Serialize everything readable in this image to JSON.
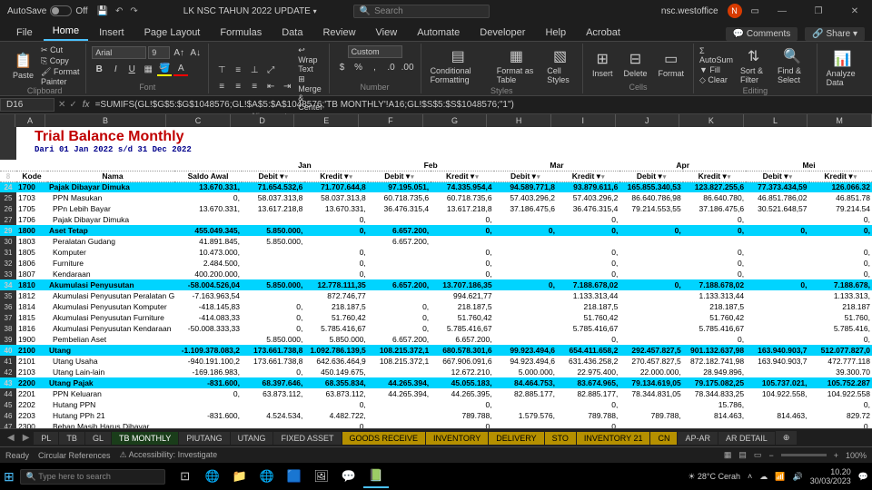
{
  "titlebar": {
    "autosave": "AutoSave",
    "off": "Off",
    "docname": "LK NSC TAHUN 2022 UPDATE",
    "search": "Search",
    "user": "nsc.westoffice",
    "initial": "N"
  },
  "tabs": {
    "items": [
      "File",
      "Home",
      "Insert",
      "Page Layout",
      "Formulas",
      "Data",
      "Review",
      "View",
      "Automate",
      "Developer",
      "Help",
      "Acrobat"
    ],
    "active": 1,
    "comments": "Comments",
    "share": "Share"
  },
  "ribbon": {
    "clipboard": {
      "paste": "Paste",
      "cut": "Cut",
      "copy": "Copy",
      "fp": "Format Painter",
      "label": "Clipboard"
    },
    "font": {
      "name": "Arial",
      "size": "9",
      "label": "Font"
    },
    "alignment": {
      "wrap": "Wrap Text",
      "merge": "Merge & Center",
      "label": "Alignment"
    },
    "number": {
      "fmt": "Custom",
      "label": "Number"
    },
    "styles": {
      "cf": "Conditional Formatting",
      "fat": "Format as Table",
      "cs": "Cell Styles",
      "label": "Styles"
    },
    "cells": {
      "insert": "Insert",
      "delete": "Delete",
      "format": "Format",
      "label": "Cells"
    },
    "editing": {
      "autosum": "AutoSum",
      "fill": "Fill",
      "clear": "Clear",
      "sort": "Sort & Filter",
      "find": "Find & Select",
      "label": "Editing"
    },
    "analysis": {
      "ad": "Analyze Data"
    }
  },
  "namebox": {
    "cell": "D16",
    "formula": "=SUMIFS(GL!$G$5:$G$1048576;GL!$A$5:$A$1048576;'TB MONTHLY'!A16;GL!$S$5:$S$1048576;\"1\")"
  },
  "sheet": {
    "title": "Trial Balance Monthly",
    "subtitle": "Dari 01 Jan 2022 s/d 31 Dec 2022",
    "cols": [
      "A",
      "B",
      "C",
      "D",
      "E",
      "F",
      "G",
      "H",
      "I",
      "J",
      "K",
      "L",
      "M"
    ],
    "months": [
      "Jan",
      "Feb",
      "Mar",
      "Apr",
      "Mei"
    ],
    "dk": [
      "Debit",
      "Kredit"
    ],
    "headers": [
      "Kode",
      "Nama",
      "Saldo Awal"
    ],
    "rows": [
      {
        "r": 24,
        "cat": true,
        "k": "1700",
        "n": "Pajak Dibayar Dimuka",
        "s": "13.670.331,",
        "d": [
          "71.654.532,6",
          "71.707.644,8",
          "97.195.051,",
          "74.335.954,4",
          "94.589.771,8",
          "93.879.611,6",
          "165.855.340,53",
          "123.827.255,6",
          "77.373.434,59",
          "126.066.32"
        ]
      },
      {
        "r": 25,
        "k": "1703",
        "n": "PPN Masukan",
        "s": "0,",
        "d": [
          "58.037.313,8",
          "58.037.313,8",
          "60.718.735,6",
          "60.718.735,6",
          "57.403.296,2",
          "57.403.296,2",
          "86.640.786,98",
          "86.640.780,",
          "46.851.786,02",
          "46.851.78"
        ]
      },
      {
        "r": 26,
        "k": "1705",
        "n": "PPn Lebih Bayar",
        "s": "13.670.331,",
        "d": [
          "13.617.218,8",
          "13.670.331,",
          "36.476.315,4",
          "13.617.218,8",
          "37.186.475,6",
          "36.476.315,4",
          "79.214.553,55",
          "37.186.475,6",
          "30.521.648,57",
          "79.214.54"
        ]
      },
      {
        "r": 27,
        "k": "1706",
        "n": "Pajak Dibayar Dimuka",
        "s": "",
        "d": [
          "",
          "0,",
          "",
          "0,",
          "",
          "0,",
          "",
          "0,",
          "",
          "0,"
        ]
      },
      {
        "r": 29,
        "cat": true,
        "k": "1800",
        "n": "Aset Tetap",
        "s": "455.049.345,",
        "d": [
          "5.850.000,",
          "0,",
          "6.657.200,",
          "0,",
          "0,",
          "0,",
          "0,",
          "0,",
          "0,",
          "0,"
        ]
      },
      {
        "r": 30,
        "k": "1803",
        "n": "Peralatan Gudang",
        "s": "41.891.845,",
        "d": [
          "5.850.000,",
          "",
          "6.657.200,",
          "",
          "",
          "",
          "",
          "",
          "",
          ""
        ]
      },
      {
        "r": 31,
        "k": "1805",
        "n": "Komputer",
        "s": "10.473.000,",
        "d": [
          "",
          "0,",
          "",
          "0,",
          "",
          "0,",
          "",
          "0,",
          "",
          "0,"
        ]
      },
      {
        "r": 32,
        "k": "1806",
        "n": "Furniture",
        "s": "2.484.500,",
        "d": [
          "",
          "0,",
          "",
          "0,",
          "",
          "0,",
          "",
          "0,",
          "",
          "0,"
        ]
      },
      {
        "r": 33,
        "k": "1807",
        "n": "Kendaraan",
        "s": "400.200.000,",
        "d": [
          "",
          "0,",
          "",
          "0,",
          "",
          "0,",
          "",
          "0,",
          "",
          "0,"
        ]
      },
      {
        "r": 34,
        "cat": true,
        "k": "1810",
        "n": "Akumulasi Penyusutan",
        "s": "-58.004.526,04",
        "d": [
          "5.850.000,",
          "12.778.111,35",
          "6.657.200,",
          "13.707.186,35",
          "0,",
          "7.188.678,02",
          "0,",
          "7.188.678,02",
          "0,",
          "7.188.678,"
        ]
      },
      {
        "r": 35,
        "k": "1812",
        "n": "Akumulasi Penyusutan Peralatan Gudang",
        "s": "-7.163.963,54",
        "d": [
          "",
          "872.746,77",
          "",
          "994.621,77",
          "",
          "1.133.313,44",
          "",
          "1.133.313,44",
          "",
          "1.133.313,"
        ]
      },
      {
        "r": 36,
        "k": "1814",
        "n": "Akumulasi Penyusutan Komputer",
        "s": "-418.145,83",
        "d": [
          "0,",
          "218.187,5",
          "0,",
          "218.187,5",
          "",
          "218.187,5",
          "",
          "218.187,5",
          "",
          "218.187"
        ]
      },
      {
        "r": 37,
        "k": "1815",
        "n": "Akumulasi Penyusutan Furniture",
        "s": "-414.083,33",
        "d": [
          "0,",
          "51.760,42",
          "0,",
          "51.760,42",
          "",
          "51.760,42",
          "",
          "51.760,42",
          "",
          "51.760,"
        ]
      },
      {
        "r": 38,
        "k": "1816",
        "n": "Akumulasi Penyusutan Kendaraan",
        "s": "-50.008.333,33",
        "d": [
          "0,",
          "5.785.416,67",
          "0,",
          "5.785.416,67",
          "",
          "5.785.416,67",
          "",
          "5.785.416,67",
          "",
          "5.785.416,"
        ]
      },
      {
        "r": 39,
        "k": "1900",
        "n": "Pembelian Aset",
        "s": "",
        "d": [
          "5.850.000,",
          "5.850.000,",
          "6.657.200,",
          "6.657.200,",
          "",
          "0,",
          "",
          "0,",
          "",
          "0,"
        ]
      },
      {
        "r": 40,
        "cat": true,
        "k": "2100",
        "n": "Utang",
        "s": "-1.109.378.083,2",
        "d": [
          "173.661.738,8",
          "1.092.786.139,5",
          "108.215.372,1",
          "680.578.301,6",
          "99.923.494,6",
          "654.411.658,2",
          "292.457.827,5",
          "901.132.637,98",
          "163.940.903,7",
          "512.077.827,0"
        ]
      },
      {
        "r": 41,
        "k": "2101",
        "n": "Utang Usaha",
        "s": "-940.191.100,2",
        "d": [
          "173.661.738,8",
          "642.636.464,9",
          "108.215.372,1",
          "667.906.091,6",
          "94.923.494,6",
          "631.436.258,2",
          "270.457.827,5",
          "872.182.741,98",
          "163.940.903,7",
          "472.777.118"
        ]
      },
      {
        "r": 42,
        "k": "2103",
        "n": "Utang Lain-lain",
        "s": "-169.186.983,",
        "d": [
          "0,",
          "450.149.675,",
          "",
          "12.672.210,",
          "5.000.000,",
          "22.975.400,",
          "22.000.000,",
          "28.949.896,",
          "",
          "39.300.70"
        ]
      },
      {
        "r": 43,
        "cat": true,
        "k": "2200",
        "n": "Utang Pajak",
        "s": "-831.600,",
        "d": [
          "68.397.646,",
          "68.355.834,",
          "44.265.394,",
          "45.055.183,",
          "84.464.753,",
          "83.674.965,",
          "79.134.619,05",
          "79.175.082,25",
          "105.737.021,",
          "105.752.287"
        ]
      },
      {
        "r": 44,
        "k": "2201",
        "n": "PPN Keluaran",
        "s": "0,",
        "d": [
          "63.873.112,",
          "63.873.112,",
          "44.265.394,",
          "44.265.395,",
          "82.885.177,",
          "82.885.177,",
          "78.344.831,05",
          "78.344.833,25",
          "104.922.558,",
          "104.922.558"
        ]
      },
      {
        "r": 45,
        "k": "2202",
        "n": "Hutang PPN",
        "s": "",
        "d": [
          "",
          "0,",
          "",
          "0,",
          "",
          "0,",
          "",
          "15.786,",
          "",
          "0,"
        ]
      },
      {
        "r": 46,
        "k": "2203",
        "n": "Hutang PPh 21",
        "s": "-831.600,",
        "d": [
          "4.524.534,",
          "4.482.722,",
          "",
          "789.788,",
          "1.579.576,",
          "789.788,",
          "789.788,",
          "814.463,",
          "814.463,",
          "829.72"
        ]
      },
      {
        "r": 47,
        "k": "2300",
        "n": "Beban Masih Harus Dibayar",
        "s": "",
        "d": [
          "",
          "0,",
          "",
          "0,",
          "",
          "0,",
          "",
          "",
          "",
          "0,"
        ]
      }
    ]
  },
  "sheets": {
    "items": [
      "PL",
      "TB",
      "GL",
      "TB MONTHLY",
      "PIUTANG",
      "UTANG",
      "FIXED ASSET",
      "GOODS RECEIVE",
      "INVENTORY",
      "DELIVERY",
      "STO",
      "INVENTORY 21",
      "CN",
      "AP-AR",
      "AR DETAIL"
    ],
    "active": 3,
    "yellow": [
      7,
      8,
      9,
      10,
      11,
      12
    ]
  },
  "status": {
    "ready": "Ready",
    "circ": "Circular References",
    "acc": "Accessibility: Investigate",
    "zoom": "100%"
  },
  "taskbar": {
    "search": "Type here to search",
    "weather": "28°C Cerah",
    "time": "10.20",
    "date": "30/03/2023"
  }
}
